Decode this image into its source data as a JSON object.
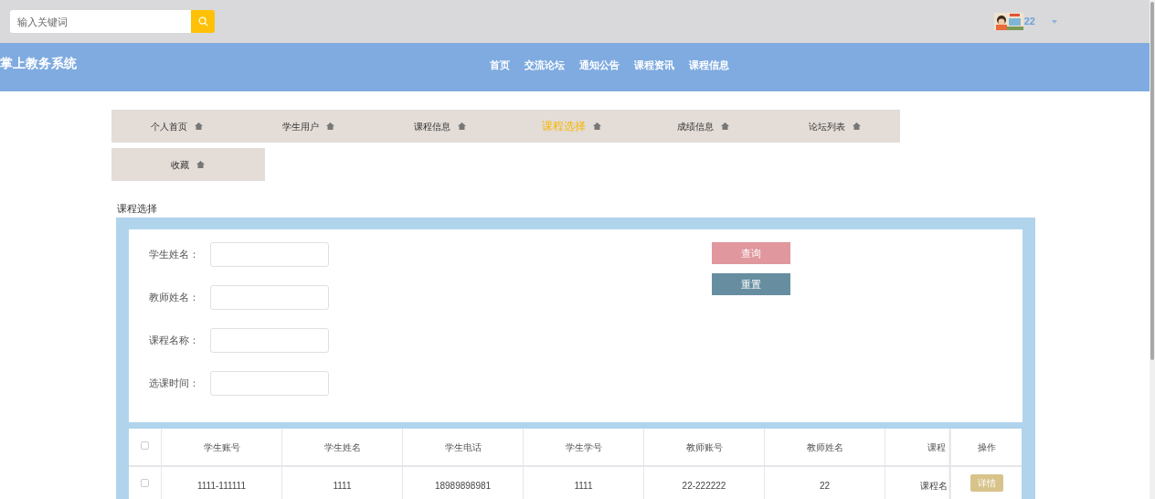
{
  "search": {
    "placeholder": "输入关键词"
  },
  "user": {
    "name": "22"
  },
  "brand": "掌上教务系统",
  "nav": [
    "首页",
    "交流论坛",
    "通知公告",
    "课程资讯",
    "课程信息"
  ],
  "menu_tabs": [
    {
      "label": "个人首页",
      "selected": false
    },
    {
      "label": "学生用户",
      "selected": false
    },
    {
      "label": "课程信息",
      "selected": false
    },
    {
      "label": "课程选择",
      "selected": true
    },
    {
      "label": "成绩信息",
      "selected": false
    },
    {
      "label": "论坛列表",
      "selected": false
    },
    {
      "label": "收藏",
      "selected": false
    }
  ],
  "section_title": "课程选择",
  "filters": [
    {
      "label": "学生姓名："
    },
    {
      "label": "教师姓名："
    },
    {
      "label": "课程名称："
    },
    {
      "label": "选课时间："
    }
  ],
  "buttons": [
    {
      "label": "查询",
      "kind": "primary"
    },
    {
      "label": "重置",
      "kind": "secondary"
    }
  ],
  "table": {
    "columns": [
      "学生账号",
      "学生姓名",
      "学生电话",
      "学生学号",
      "教师账号",
      "教师姓名",
      "课程"
    ],
    "action_column": "操作",
    "select_all": {
      "checked": false
    },
    "rows": [
      {
        "checked": false,
        "cells": [
          "1111-111111",
          "1111",
          "18989898981",
          "1111",
          "22-222222",
          "22",
          "课程名"
        ],
        "action": "详情"
      }
    ]
  }
}
